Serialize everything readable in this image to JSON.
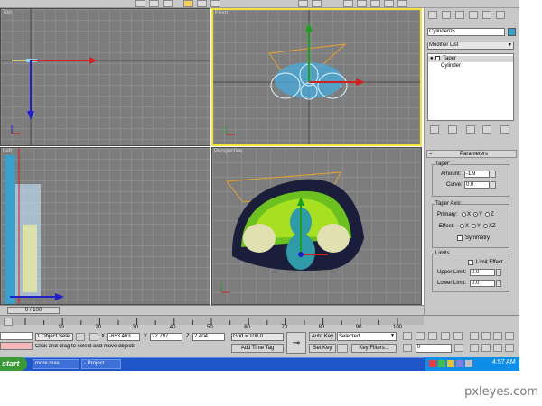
{
  "viewports": {
    "top": {
      "label": "Top"
    },
    "front": {
      "label": "Front"
    },
    "left": {
      "label": "Left"
    },
    "perspective": {
      "label": "Perspective"
    }
  },
  "command_panel": {
    "object_name": "Cylinder05",
    "object_color": "#3aa0c8",
    "modifier_list_label": "Modifier List",
    "stack": [
      "Taper",
      "Cylinder"
    ],
    "rollout_title": "Parameters",
    "taper": {
      "group_label": "Taper:",
      "amount_label": "Amount:",
      "amount_value": "-1.9",
      "curve_label": "Curve:",
      "curve_value": "0.0"
    },
    "taper_axis": {
      "group_label": "Taper Axis:",
      "primary_label": "Primary:",
      "primary_options": [
        "X",
        "Y",
        "Z"
      ],
      "effect_label": "Effect:",
      "effect_options": [
        "X",
        "Y",
        "XZ"
      ],
      "symmetry_label": "Symmetry"
    },
    "limits": {
      "group_label": "Limits",
      "limit_effect_label": "Limit Effect",
      "upper_label": "Upper Limit:",
      "upper_value": "0.0",
      "lower_label": "Lower Limit:",
      "lower_value": "0.0"
    }
  },
  "timeline": {
    "frame_display": "0 / 100",
    "ruler_ticks": [
      "10",
      "20",
      "30",
      "40",
      "50",
      "60",
      "70",
      "80",
      "90",
      "100"
    ]
  },
  "status_bar": {
    "selection_count": "1 Object Sele",
    "x_label": "X",
    "x_value": "-653.463",
    "y_label": "Y",
    "y_value": "22.797",
    "z_label": "Z",
    "z_value": "2.404",
    "grid": "Grid = 100.0",
    "prompt": "Click and drag to select and move objects",
    "add_time_tag": "Add Time Tag",
    "auto_key": "Auto Key",
    "set_key": "Set Key",
    "selected_dropdown": "Selected",
    "key_filters": "Key Filters...",
    "frame_field": "0"
  },
  "taskbar": {
    "start": "start",
    "tasks": [
      "more.max",
      "- Project..."
    ],
    "clock": "4:57 AM"
  },
  "watermark": "pxleyes.com",
  "colors": {
    "viewport_bg": "#7d7d7d",
    "active_border": "#f2e33a",
    "ui_grey": "#c8c8c8",
    "taskbar_blue": "#1e56c8",
    "start_green": "#3a9a38"
  }
}
